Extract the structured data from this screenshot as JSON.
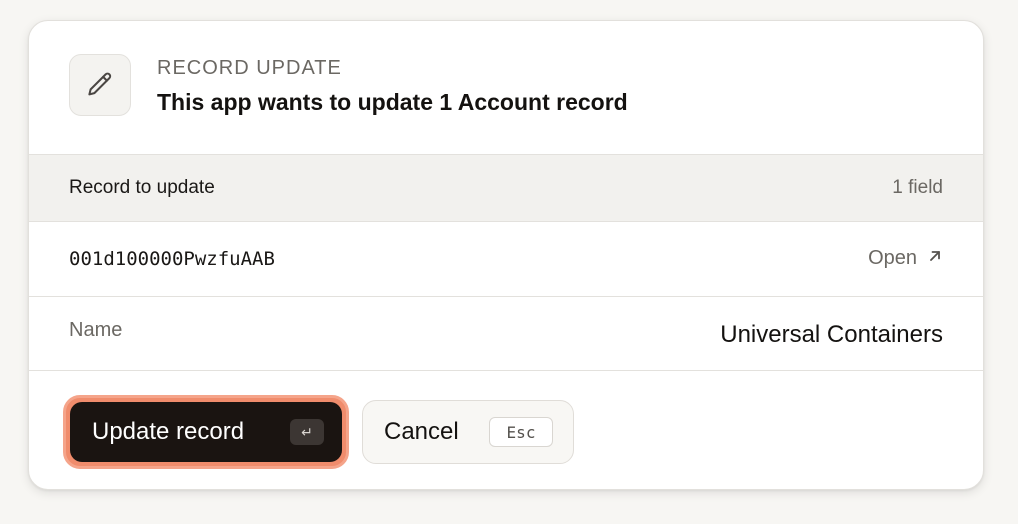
{
  "header": {
    "eyebrow": "RECORD UPDATE",
    "title": "This app wants to update 1 Account record",
    "icon": "pencil-icon"
  },
  "section": {
    "label": "Record to update",
    "count": "1 field"
  },
  "record": {
    "id": "001d100000PwzfuAAB",
    "open_label": "Open",
    "open_icon": "arrow-up-right-icon"
  },
  "fields": [
    {
      "name": "Name",
      "value": "Universal Containers"
    }
  ],
  "actions": {
    "primary_label": "Update record",
    "primary_shortcut": "↵",
    "secondary_label": "Cancel",
    "secondary_shortcut": "Esc"
  },
  "colors": {
    "primary_button": "#1a1411",
    "focus_ring": "#f08c6c"
  }
}
